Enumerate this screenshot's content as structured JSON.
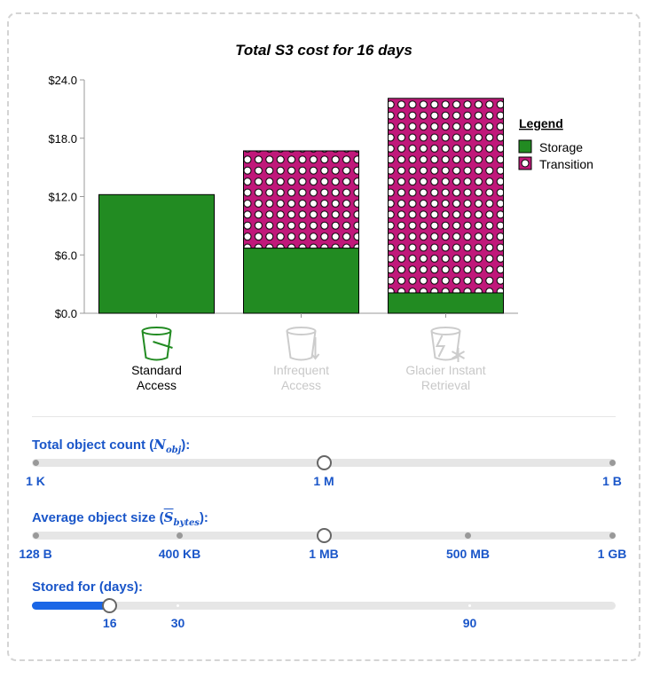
{
  "chart_data": {
    "type": "bar",
    "stacked": true,
    "title": "Total S3 cost for 16 days",
    "categories": [
      "Standard\nAccess",
      "Infrequent\nAccess",
      "Glacier Instant\nRetrieval"
    ],
    "category_active": [
      true,
      false,
      false
    ],
    "icons": [
      "bucket-icon",
      "bucket-infrequent-icon",
      "bucket-glacier-icon"
    ],
    "series": [
      {
        "name": "Storage",
        "values": [
          12.2,
          6.7,
          2.1
        ],
        "color": "#228b22",
        "pattern": "solid"
      },
      {
        "name": "Transition",
        "values": [
          0,
          10.0,
          20.0
        ],
        "color": "#c0187a",
        "pattern": "dots"
      }
    ],
    "ylim": [
      0,
      24
    ],
    "yticks": [
      "$0.0",
      "$6.0",
      "$12.0",
      "$18.0",
      "$24.0"
    ],
    "ytick_values": [
      0,
      6,
      12,
      18,
      24
    ],
    "legend": {
      "title": "Legend",
      "placement": "right"
    },
    "xlabel": "",
    "ylabel": ""
  },
  "controls": {
    "object_count": {
      "label_prefix": "Total object count (",
      "math": "N",
      "sub": "obj",
      "label_suffix": "):",
      "ticks": [
        "1 K",
        "1 M",
        "1 B"
      ],
      "tick_fracs": [
        0,
        0.5,
        1
      ],
      "value_fraction": 0.5
    },
    "object_size": {
      "label_prefix": "Average object size (",
      "math": "S",
      "sub": "bytes",
      "label_suffix": "):",
      "ticks": [
        "128 B",
        "400 KB",
        "1 MB",
        "500 MB",
        "1 GB"
      ],
      "tick_fracs": [
        0,
        0.25,
        0.5,
        0.75,
        1
      ],
      "value_fraction": 0.5
    },
    "stored_days": {
      "label": "Stored for (days):",
      "value": 16,
      "min": 0,
      "max": 120,
      "ticks": [
        "30",
        "90"
      ],
      "tick_values": [
        30,
        90
      ]
    }
  }
}
